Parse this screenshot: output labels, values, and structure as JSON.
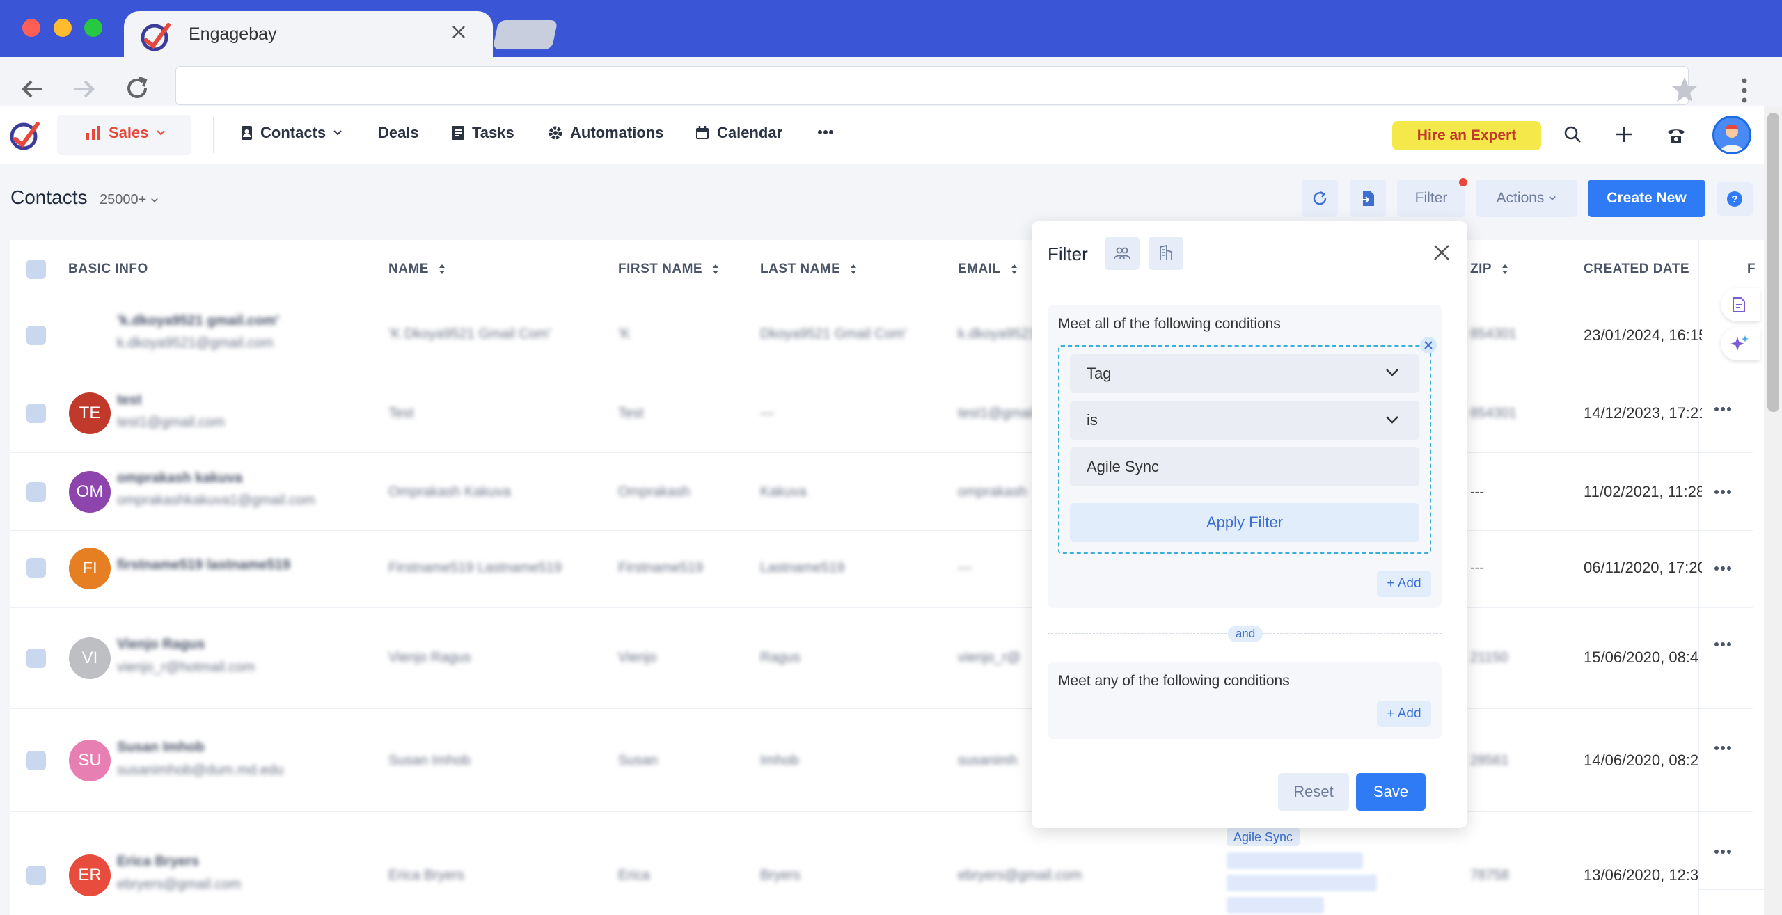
{
  "browser": {
    "tab_title": "Engagebay",
    "url": ""
  },
  "nav": {
    "sales": "Sales",
    "contacts": "Contacts",
    "deals": "Deals",
    "tasks": "Tasks",
    "automations": "Automations",
    "calendar": "Calendar",
    "hire_expert": "Hire an Expert"
  },
  "page": {
    "title": "Contacts",
    "count": "25000+",
    "filter_label": "Filter",
    "actions_label": "Actions",
    "create_label": "Create New"
  },
  "table": {
    "headers": {
      "basic_info": "BASIC INFO",
      "name": "NAME",
      "first_name": "FIRST NAME",
      "last_name": "LAST NAME",
      "email": "EMAIL",
      "zip": "ZIP",
      "created_date": "CREATED DATE",
      "extra": "F"
    },
    "rows": [
      {
        "initials": "",
        "name_line": "'k.dkoya9521 gmail.com'",
        "email_line": "k.dkoya9521@gmail.com",
        "name": "'K Dkoya9521 Gmail Com'",
        "first": "'K",
        "last": "Dkoya9521 Gmail Com'",
        "email": "k.dkoya9521@",
        "zip": "854301",
        "created": "23/01/2024, 16:15"
      },
      {
        "initials": "TE",
        "name_line": "test",
        "email_line": "test1@gmail.com",
        "name": "Test",
        "first": "Test",
        "last": "---",
        "email": "test1@gmail",
        "zip": "854301",
        "created": "14/12/2023, 17:21"
      },
      {
        "initials": "OM",
        "name_line": "omprakash kakuva",
        "email_line": "omprakashkakuva1@gmail.com",
        "name": "Omprakash Kakuva",
        "first": "Omprakash",
        "last": "Kakuva",
        "email": "omprakash",
        "zip": "---",
        "created": "11/02/2021, 11:28"
      },
      {
        "initials": "FI",
        "name_line": "firstname519 lastname519",
        "email_line": "",
        "name": "Firstname519 Lastname519",
        "first": "Firstname519",
        "last": "Lastname519",
        "email": "---",
        "zip": "---",
        "created": "06/11/2020, 17:20"
      },
      {
        "initials": "VI",
        "name_line": "Vienjo Ragus",
        "email_line": "vienjo_r@hotmail.com",
        "name": "Vienjo Ragus",
        "first": "Vienjo",
        "last": "Ragus",
        "email": "vienjo_r@",
        "zip": "21150",
        "created": "15/06/2020, 08:4"
      },
      {
        "initials": "SU",
        "name_line": "Susan Imhob",
        "email_line": "susanimhob@dum.md.edu",
        "name": "Susan Imhob",
        "first": "Susan",
        "last": "Imhob",
        "email": "susanimh",
        "zip": "28561",
        "created": "14/06/2020, 08:2"
      },
      {
        "initials": "ER",
        "name_line": "Erica Bryers",
        "email_line": "ebryers@gmail.com",
        "name": "Erica Bryers",
        "first": "Erica",
        "last": "Bryers",
        "email": "ebryers@gmail.com",
        "zip": "78758",
        "created": "13/06/2020, 12:3"
      }
    ],
    "row_tag": "Agile Sync"
  },
  "filter": {
    "title": "Filter",
    "all_conditions": "Meet all of the following conditions",
    "field": "Tag",
    "operator": "is",
    "value": "Agile Sync",
    "apply": "Apply Filter",
    "add": "+ Add",
    "and": "and",
    "any_conditions": "Meet any of the following conditions",
    "reset": "Reset",
    "save": "Save"
  },
  "colors": {
    "browser_bar": "#3a55d6",
    "primary": "#2f7bf5",
    "sales": "#e8483b",
    "hire_bg": "#f5e84a",
    "dashed": "#3ab0d8"
  },
  "avatar_colors": [
    "#ffffff",
    "#c0392b",
    "#8e44ad",
    "#e67e22",
    "#bdbfc2",
    "#e77fb3",
    "#e74c3c"
  ]
}
